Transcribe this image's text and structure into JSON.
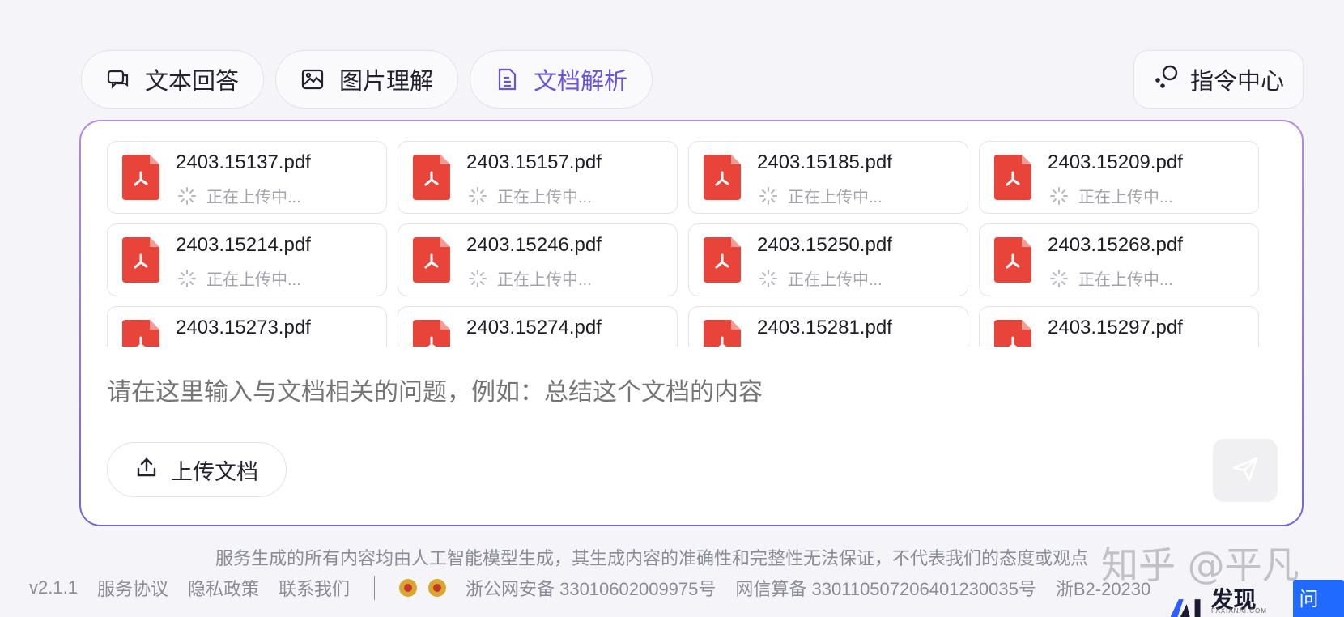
{
  "tabs": [
    {
      "label": "文本回答",
      "icon": "chat-icon",
      "active": false
    },
    {
      "label": "图片理解",
      "icon": "image-icon",
      "active": false
    },
    {
      "label": "文档解析",
      "icon": "document-icon",
      "active": true
    }
  ],
  "command_center": {
    "label": "指令中心",
    "icon": "command-icon"
  },
  "files": [
    {
      "name": "2403.15137.pdf",
      "status": "正在上传中..."
    },
    {
      "name": "2403.15157.pdf",
      "status": "正在上传中..."
    },
    {
      "name": "2403.15185.pdf",
      "status": "正在上传中..."
    },
    {
      "name": "2403.15209.pdf",
      "status": "正在上传中..."
    },
    {
      "name": "2403.15214.pdf",
      "status": "正在上传中..."
    },
    {
      "name": "2403.15246.pdf",
      "status": "正在上传中..."
    },
    {
      "name": "2403.15250.pdf",
      "status": "正在上传中..."
    },
    {
      "name": "2403.15268.pdf",
      "status": "正在上传中..."
    },
    {
      "name": "2403.15273.pdf",
      "status": ""
    },
    {
      "name": "2403.15274.pdf",
      "status": ""
    },
    {
      "name": "2403.15281.pdf",
      "status": ""
    },
    {
      "name": "2403.15297.pdf",
      "status": ""
    }
  ],
  "input": {
    "placeholder": "请在这里输入与文档相关的问题，例如：总结这个文档的内容"
  },
  "upload_button": {
    "label": "上传文档",
    "icon": "upload-icon"
  },
  "send_button": {
    "icon": "send-icon"
  },
  "disclaimer": "服务生成的所有内容均由人工智能模型生成，其生成内容的准确性和完整性无法保证，不代表我们的态度或观点",
  "footer": {
    "version": "v2.1.1",
    "links": [
      "服务协议",
      "隐私政策",
      "联系我们"
    ],
    "icp1": "浙公网安备 33010602009975号",
    "icp2": "网信算备 330110507206401230035号",
    "icp3": "浙B2-20230"
  },
  "watermark": "知乎 @平凡",
  "brand": {
    "name": "发现AI",
    "sub": "FAXIANAI.COM",
    "tag": "问答"
  },
  "colors": {
    "accent": "#6a55d8",
    "pdf_red": "#e8443a",
    "border_gradient_start": "#b58be0",
    "border_gradient_end": "#7a63d9"
  }
}
